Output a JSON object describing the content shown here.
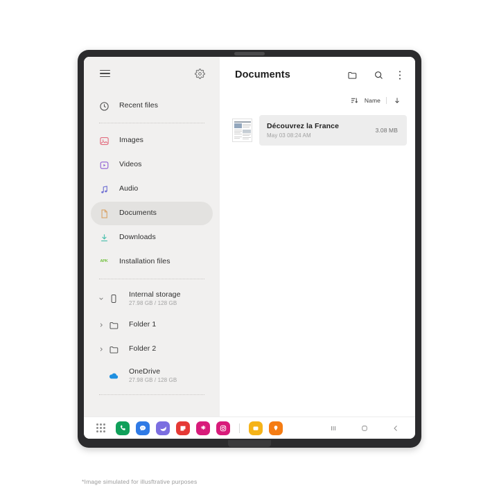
{
  "caption": "*Image simulated for illusftrative purposes",
  "sidebar": {
    "menu_icon": "hamburger-menu-icon",
    "settings_icon": "gear-icon",
    "items": [
      {
        "label": "Recent files",
        "icon": "clock-icon",
        "selected": false
      },
      {
        "label": "Images",
        "icon": "image-icon",
        "selected": false
      },
      {
        "label": "Videos",
        "icon": "video-icon",
        "selected": false
      },
      {
        "label": "Audio",
        "icon": "audio-note-icon",
        "selected": false
      },
      {
        "label": "Documents",
        "icon": "document-icon",
        "selected": true
      },
      {
        "label": "Downloads",
        "icon": "download-icon",
        "selected": false
      },
      {
        "label": "Installation files",
        "icon": "apk-icon",
        "selected": false
      },
      {
        "label": "Internal storage",
        "sub": "27.98 GB / 128 GB",
        "icon": "phone-storage-icon",
        "selected": false,
        "chevron": "chevron-down"
      },
      {
        "label": "Folder 1",
        "icon": "folder-icon",
        "selected": false,
        "chevron": "chevron-right"
      },
      {
        "label": "Folder 2",
        "icon": "folder-icon",
        "selected": false,
        "chevron": "chevron-right"
      },
      {
        "label": "OneDrive",
        "sub": "27.98 GB / 128 GB",
        "icon": "cloud-icon",
        "selected": false
      }
    ]
  },
  "main": {
    "title": "Documents",
    "actions": [
      {
        "name": "new-folder-icon",
        "label": "New folder"
      },
      {
        "name": "search-icon",
        "label": "Search"
      },
      {
        "name": "more-options-icon",
        "label": "More options"
      }
    ],
    "sort": {
      "icon": "sort-icon",
      "label": "Name",
      "direction_icon": "arrow-down-icon"
    },
    "files": [
      {
        "name": "Découvrez la France",
        "date": "May 03 08:24 AM",
        "size": "3.08 MB",
        "thumb": "document-preview-thumbnail"
      }
    ]
  },
  "taskbar": {
    "apps_icon": "apps-grid-icon",
    "apps": [
      {
        "name": "phone-app-icon",
        "color": "#10a05a"
      },
      {
        "name": "messages-app-icon",
        "color": "#2f7ae5"
      },
      {
        "name": "internet-app-icon",
        "color": "#7b6ee0"
      },
      {
        "name": "notes-app-icon",
        "color": "#e53935"
      },
      {
        "name": "galaxy-store-app-icon",
        "color": "#d81b7a"
      },
      {
        "name": "instagram-app-icon",
        "color": "#d81b7a"
      },
      {
        "name": "my-files-app-icon",
        "color": "#f5b318"
      },
      {
        "name": "maps-app-icon",
        "color": "#f57c13"
      }
    ],
    "nav": [
      {
        "name": "recent-apps-button"
      },
      {
        "name": "home-button"
      },
      {
        "name": "back-button"
      }
    ]
  },
  "colors": {
    "sidebar_bg": "#f1f0ef",
    "selected_bg": "#e3e2e0",
    "file_row_bg": "#ededed",
    "frame": "#2b2b2d"
  }
}
